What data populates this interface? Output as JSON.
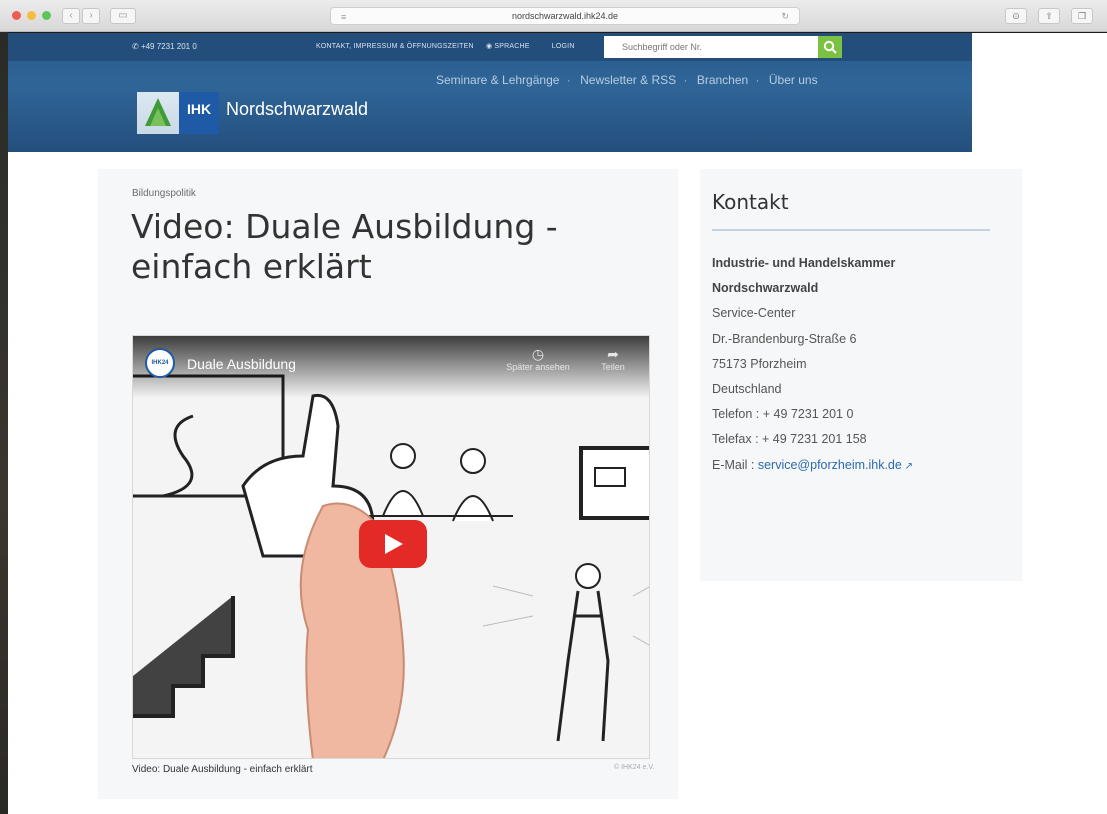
{
  "browser": {
    "url": "nordschwarzwald.ihk24.de"
  },
  "header": {
    "phone": "+49 7231 201 0",
    "top_links": [
      "KONTAKT, IMPRESSUM & ÖFFNUNGSZEITEN",
      "SPRACHE",
      "LOGIN"
    ],
    "search_placeholder": "Suchbegriff oder Nr.",
    "nav": [
      "Seminare & Lehrgänge",
      "Newsletter & RSS",
      "Branchen",
      "Über uns"
    ],
    "logo_text": "IHK",
    "brand": "Nordschwarzwald"
  },
  "article": {
    "kicker": "Bildungspolitik",
    "title": "Video: Duale Ausbildung - einfach erklärt",
    "video": {
      "channel": "IHK24",
      "title": "Duale Ausbildung",
      "watch_later": "Später ansehen",
      "share": "Teilen"
    },
    "caption": "Video: Duale Ausbildung - einfach erklärt",
    "credit": "© IHK24 e.V."
  },
  "sidebar": {
    "title": "Kontakt",
    "org_line1": "Industrie- und Handelskammer",
    "org_line2": "Nordschwarzwald",
    "dept": "Service-Center",
    "street": "Dr.-Brandenburg-Straße 6",
    "city": "75173 Pforzheim",
    "country": "Deutschland",
    "phone": "Telefon : + 49 7231 201 0",
    "fax": "Telefax : + 49 7231 201 158",
    "email_label": "E-Mail : ",
    "email": "service@pforzheim.ihk.de"
  },
  "colors": {
    "header_blue": "#2f6597",
    "search_green": "#7cc242",
    "play_red": "#e32a27",
    "link_blue": "#2d6ab0"
  }
}
